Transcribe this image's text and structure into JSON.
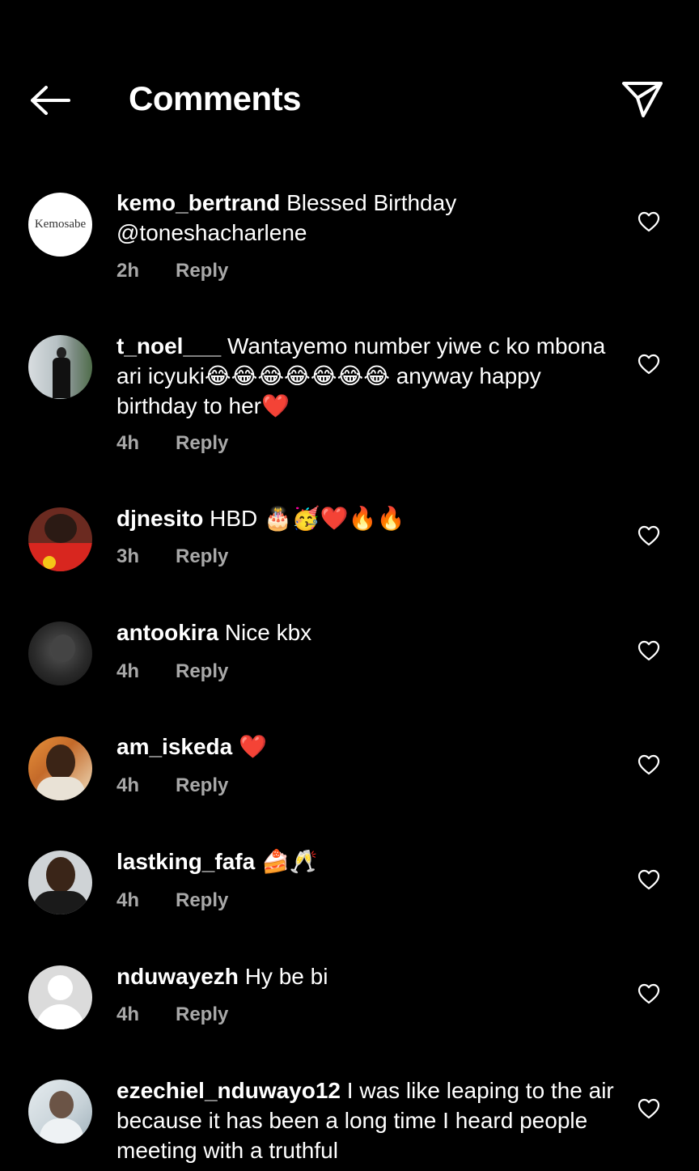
{
  "header": {
    "title": "Comments"
  },
  "comments": [
    {
      "username": "kemo_bertrand",
      "text": "Blessed Birthday @toneshacharlene",
      "time": "2h",
      "reply": "Reply",
      "avatar_label": "Kemosabe"
    },
    {
      "username": "t_noel___",
      "text": "Wantayemo number yiwe c ko mbona ari icyuki😂😂😂😂😂😂😂 anyway happy birthday to her❤️",
      "time": "4h",
      "reply": "Reply"
    },
    {
      "username": "djnesito",
      "text": "HBD 🎂🥳❤️🔥🔥",
      "time": "3h",
      "reply": "Reply"
    },
    {
      "username": "antookira",
      "text": "Nice kbx",
      "time": "4h",
      "reply": "Reply"
    },
    {
      "username": "am_iskeda",
      "text": "❤️",
      "time": "4h",
      "reply": "Reply"
    },
    {
      "username": "lastking_fafa",
      "text": "🍰🥂",
      "time": "4h",
      "reply": "Reply"
    },
    {
      "username": "nduwayezh",
      "text": "Hy be bi",
      "time": "4h",
      "reply": "Reply"
    },
    {
      "username": "ezechiel_nduwayo12",
      "text": "I was like leaping to the air because it has been a long time I heard people meeting with a truthful",
      "time": "",
      "reply": ""
    }
  ]
}
